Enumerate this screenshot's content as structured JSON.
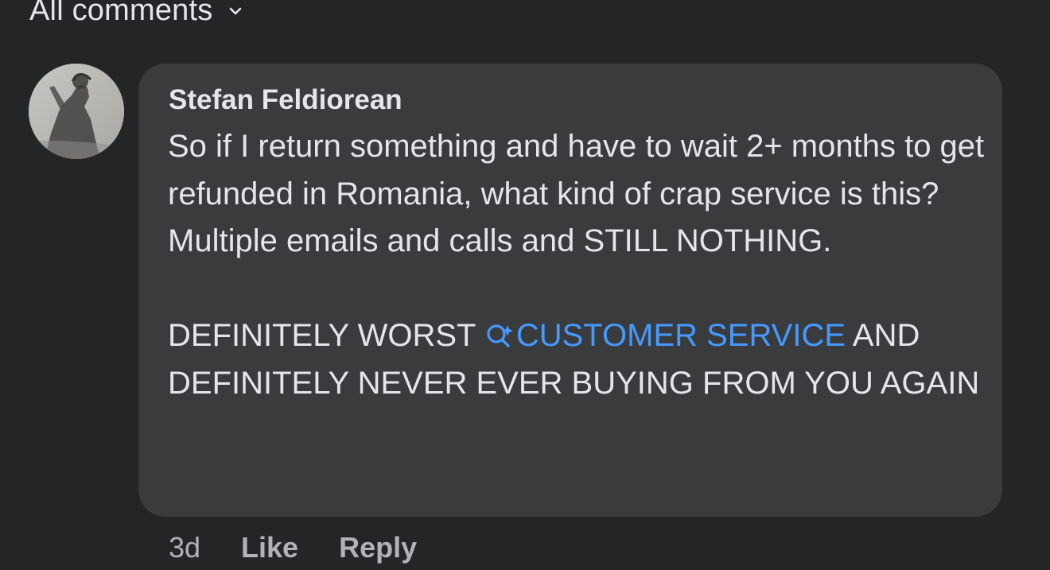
{
  "filter": {
    "label": "All comments",
    "icon": "chevron-down-icon"
  },
  "comment": {
    "author": "Stefan Feldiorean",
    "avatar_icon": "user-avatar",
    "text_part1": "So if I return something and have to wait 2+ months to get refunded in Romania, what kind of crap service is this? Multiple emails and calls and STILL NOTHING.\n\nDEFINITELY WORST ",
    "link_text": "CUSTOMER SERVICE",
    "link_icon": "search-icon",
    "text_part2": " AND DEFINITELY NEVER EVER BUYING FROM YOU AGAIN",
    "timestamp": "3d",
    "like_label": "Like",
    "reply_label": "Reply"
  },
  "colors": {
    "background": "#242526",
    "bubble": "#3a3b3c",
    "text": "#e4e6eb",
    "secondary_text": "#b0b3b8",
    "link": "#4599ff"
  }
}
